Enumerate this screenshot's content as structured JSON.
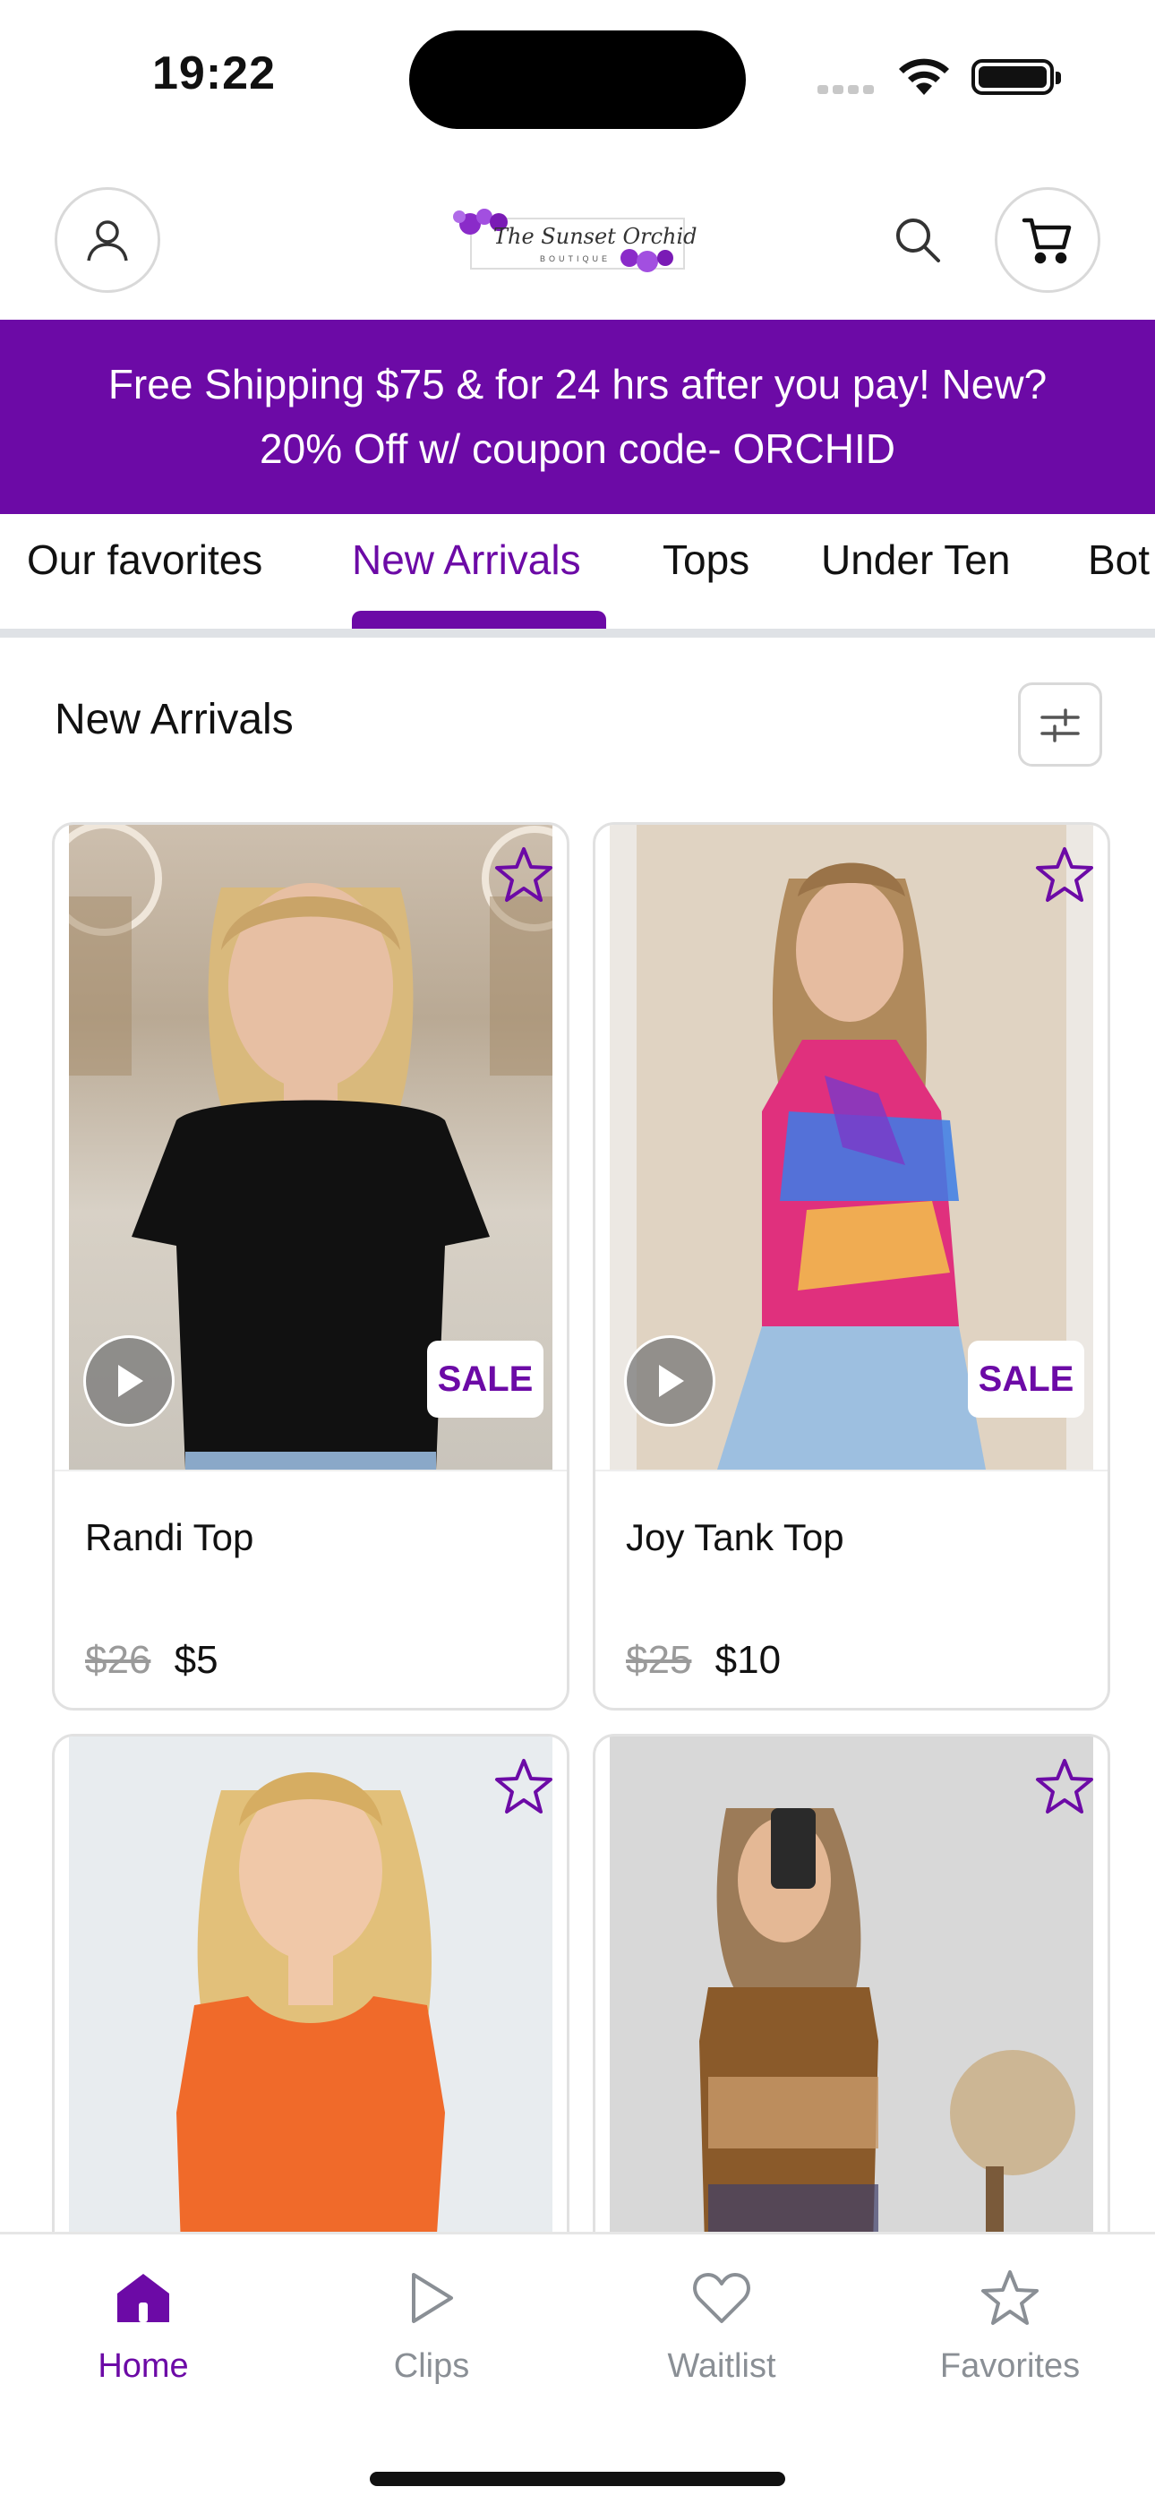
{
  "status_bar": {
    "time": "19:22"
  },
  "header": {
    "logo_text": "The Sunset Orchid",
    "logo_subtext": "BOUTIQUE"
  },
  "promo_banner": {
    "line1": "Free Shipping $75 & for 24 hrs after you pay! New?",
    "line2": "20% Off w/ coupon code- ORCHID"
  },
  "tabs": [
    {
      "label": "Our favorites"
    },
    {
      "label": "New Arrivals"
    },
    {
      "label": "Tops"
    },
    {
      "label": "Under Ten"
    },
    {
      "label": "Bot"
    }
  ],
  "active_tab_index": 1,
  "section": {
    "title": "New Arrivals"
  },
  "products": [
    {
      "name": "Randi Top",
      "old_price": "$26",
      "price": "$5",
      "badge": "SALE",
      "has_video": true
    },
    {
      "name": "Joy Tank Top",
      "old_price": "$25",
      "price": "$10",
      "badge": "SALE",
      "has_video": true
    },
    {
      "name": "",
      "has_video": false
    },
    {
      "name": "",
      "has_video": false
    }
  ],
  "bottom_nav": [
    {
      "label": "Home",
      "icon": "home-icon",
      "active": true
    },
    {
      "label": "Clips",
      "icon": "play-icon",
      "active": false
    },
    {
      "label": "Waitlist",
      "icon": "heart-icon",
      "active": false
    },
    {
      "label": "Favorites",
      "icon": "star-icon",
      "active": false
    }
  ],
  "colors": {
    "accent": "#6c0aa6",
    "inactive": "#8a8f95",
    "border": "#e1e1e1"
  }
}
